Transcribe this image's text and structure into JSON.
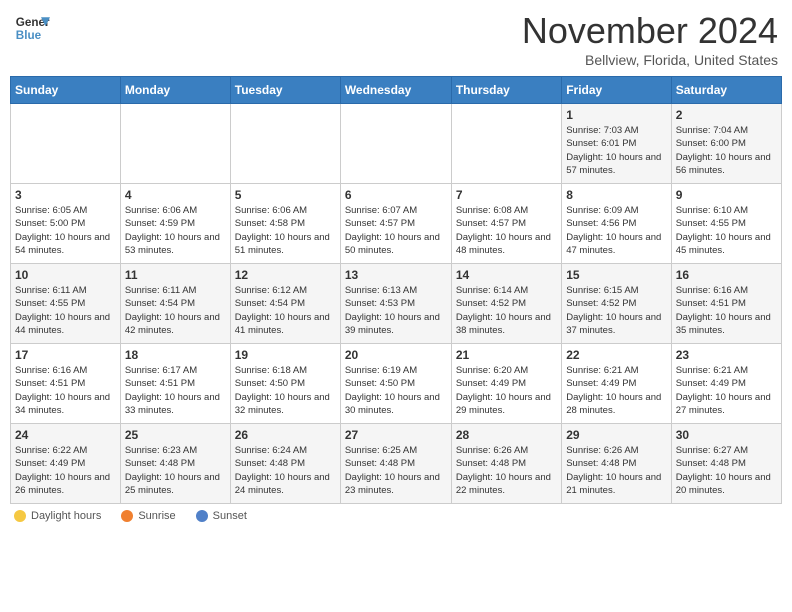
{
  "header": {
    "logo_general": "General",
    "logo_blue": "Blue",
    "month_title": "November 2024",
    "location": "Bellview, Florida, United States"
  },
  "days_of_week": [
    "Sunday",
    "Monday",
    "Tuesday",
    "Wednesday",
    "Thursday",
    "Friday",
    "Saturday"
  ],
  "weeks": [
    [
      {
        "day": "",
        "info": ""
      },
      {
        "day": "",
        "info": ""
      },
      {
        "day": "",
        "info": ""
      },
      {
        "day": "",
        "info": ""
      },
      {
        "day": "",
        "info": ""
      },
      {
        "day": "1",
        "info": "Sunrise: 7:03 AM\nSunset: 6:01 PM\nDaylight: 10 hours and 57 minutes."
      },
      {
        "day": "2",
        "info": "Sunrise: 7:04 AM\nSunset: 6:00 PM\nDaylight: 10 hours and 56 minutes."
      }
    ],
    [
      {
        "day": "3",
        "info": "Sunrise: 6:05 AM\nSunset: 5:00 PM\nDaylight: 10 hours and 54 minutes."
      },
      {
        "day": "4",
        "info": "Sunrise: 6:06 AM\nSunset: 4:59 PM\nDaylight: 10 hours and 53 minutes."
      },
      {
        "day": "5",
        "info": "Sunrise: 6:06 AM\nSunset: 4:58 PM\nDaylight: 10 hours and 51 minutes."
      },
      {
        "day": "6",
        "info": "Sunrise: 6:07 AM\nSunset: 4:57 PM\nDaylight: 10 hours and 50 minutes."
      },
      {
        "day": "7",
        "info": "Sunrise: 6:08 AM\nSunset: 4:57 PM\nDaylight: 10 hours and 48 minutes."
      },
      {
        "day": "8",
        "info": "Sunrise: 6:09 AM\nSunset: 4:56 PM\nDaylight: 10 hours and 47 minutes."
      },
      {
        "day": "9",
        "info": "Sunrise: 6:10 AM\nSunset: 4:55 PM\nDaylight: 10 hours and 45 minutes."
      }
    ],
    [
      {
        "day": "10",
        "info": "Sunrise: 6:11 AM\nSunset: 4:55 PM\nDaylight: 10 hours and 44 minutes."
      },
      {
        "day": "11",
        "info": "Sunrise: 6:11 AM\nSunset: 4:54 PM\nDaylight: 10 hours and 42 minutes."
      },
      {
        "day": "12",
        "info": "Sunrise: 6:12 AM\nSunset: 4:54 PM\nDaylight: 10 hours and 41 minutes."
      },
      {
        "day": "13",
        "info": "Sunrise: 6:13 AM\nSunset: 4:53 PM\nDaylight: 10 hours and 39 minutes."
      },
      {
        "day": "14",
        "info": "Sunrise: 6:14 AM\nSunset: 4:52 PM\nDaylight: 10 hours and 38 minutes."
      },
      {
        "day": "15",
        "info": "Sunrise: 6:15 AM\nSunset: 4:52 PM\nDaylight: 10 hours and 37 minutes."
      },
      {
        "day": "16",
        "info": "Sunrise: 6:16 AM\nSunset: 4:51 PM\nDaylight: 10 hours and 35 minutes."
      }
    ],
    [
      {
        "day": "17",
        "info": "Sunrise: 6:16 AM\nSunset: 4:51 PM\nDaylight: 10 hours and 34 minutes."
      },
      {
        "day": "18",
        "info": "Sunrise: 6:17 AM\nSunset: 4:51 PM\nDaylight: 10 hours and 33 minutes."
      },
      {
        "day": "19",
        "info": "Sunrise: 6:18 AM\nSunset: 4:50 PM\nDaylight: 10 hours and 32 minutes."
      },
      {
        "day": "20",
        "info": "Sunrise: 6:19 AM\nSunset: 4:50 PM\nDaylight: 10 hours and 30 minutes."
      },
      {
        "day": "21",
        "info": "Sunrise: 6:20 AM\nSunset: 4:49 PM\nDaylight: 10 hours and 29 minutes."
      },
      {
        "day": "22",
        "info": "Sunrise: 6:21 AM\nSunset: 4:49 PM\nDaylight: 10 hours and 28 minutes."
      },
      {
        "day": "23",
        "info": "Sunrise: 6:21 AM\nSunset: 4:49 PM\nDaylight: 10 hours and 27 minutes."
      }
    ],
    [
      {
        "day": "24",
        "info": "Sunrise: 6:22 AM\nSunset: 4:49 PM\nDaylight: 10 hours and 26 minutes."
      },
      {
        "day": "25",
        "info": "Sunrise: 6:23 AM\nSunset: 4:48 PM\nDaylight: 10 hours and 25 minutes."
      },
      {
        "day": "26",
        "info": "Sunrise: 6:24 AM\nSunset: 4:48 PM\nDaylight: 10 hours and 24 minutes."
      },
      {
        "day": "27",
        "info": "Sunrise: 6:25 AM\nSunset: 4:48 PM\nDaylight: 10 hours and 23 minutes."
      },
      {
        "day": "28",
        "info": "Sunrise: 6:26 AM\nSunset: 4:48 PM\nDaylight: 10 hours and 22 minutes."
      },
      {
        "day": "29",
        "info": "Sunrise: 6:26 AM\nSunset: 4:48 PM\nDaylight: 10 hours and 21 minutes."
      },
      {
        "day": "30",
        "info": "Sunrise: 6:27 AM\nSunset: 4:48 PM\nDaylight: 10 hours and 20 minutes."
      }
    ]
  ],
  "legend": [
    {
      "color": "#f5c842",
      "label": "Daylight hours"
    },
    {
      "color": "#f08030",
      "label": "Sunrise"
    },
    {
      "color": "#5080c8",
      "label": "Sunset"
    }
  ]
}
